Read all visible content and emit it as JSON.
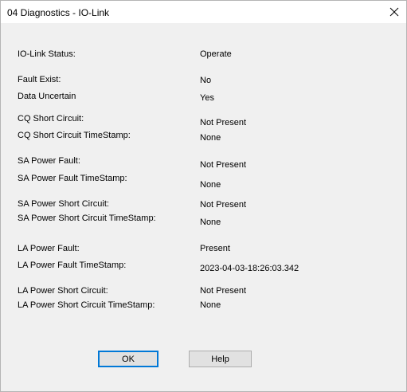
{
  "window": {
    "title": "04 Diagnostics - IO-Link",
    "close_icon": "close-icon"
  },
  "fields": [
    {
      "label": "IO-Link Status:",
      "value": "Operate"
    },
    {
      "label": "Fault Exist:",
      "value": "No"
    },
    {
      "label": "Data Uncertain",
      "value": "Yes"
    },
    {
      "label": "CQ Short Circuit:",
      "value": "Not Present"
    },
    {
      "label": "CQ Short Circuit TimeStamp:",
      "value": "None"
    },
    {
      "label": "SA Power Fault:",
      "value": "Not Present"
    },
    {
      "label": "SA Power Fault TimeStamp:",
      "value": "None"
    },
    {
      "label": "SA Power Short Circuit:",
      "value": "Not Present"
    },
    {
      "label": "SA Power Short Circuit TimeStamp:",
      "value": "None"
    },
    {
      "label": "LA Power Fault:",
      "value": "Present"
    },
    {
      "label": "LA Power Fault TimeStamp:",
      "value": "2023-04-03-18:26:03.342"
    },
    {
      "label": "LA Power Short Circuit:",
      "value": "Not Present"
    },
    {
      "label": "LA Power Short Circuit TimeStamp:",
      "value": "None"
    }
  ],
  "buttons": {
    "ok_label": "OK",
    "help_label": "Help"
  },
  "colors": {
    "title_bar": "#ffffff",
    "body": "#f0f0f0",
    "default_button_border": "#0078d7"
  }
}
